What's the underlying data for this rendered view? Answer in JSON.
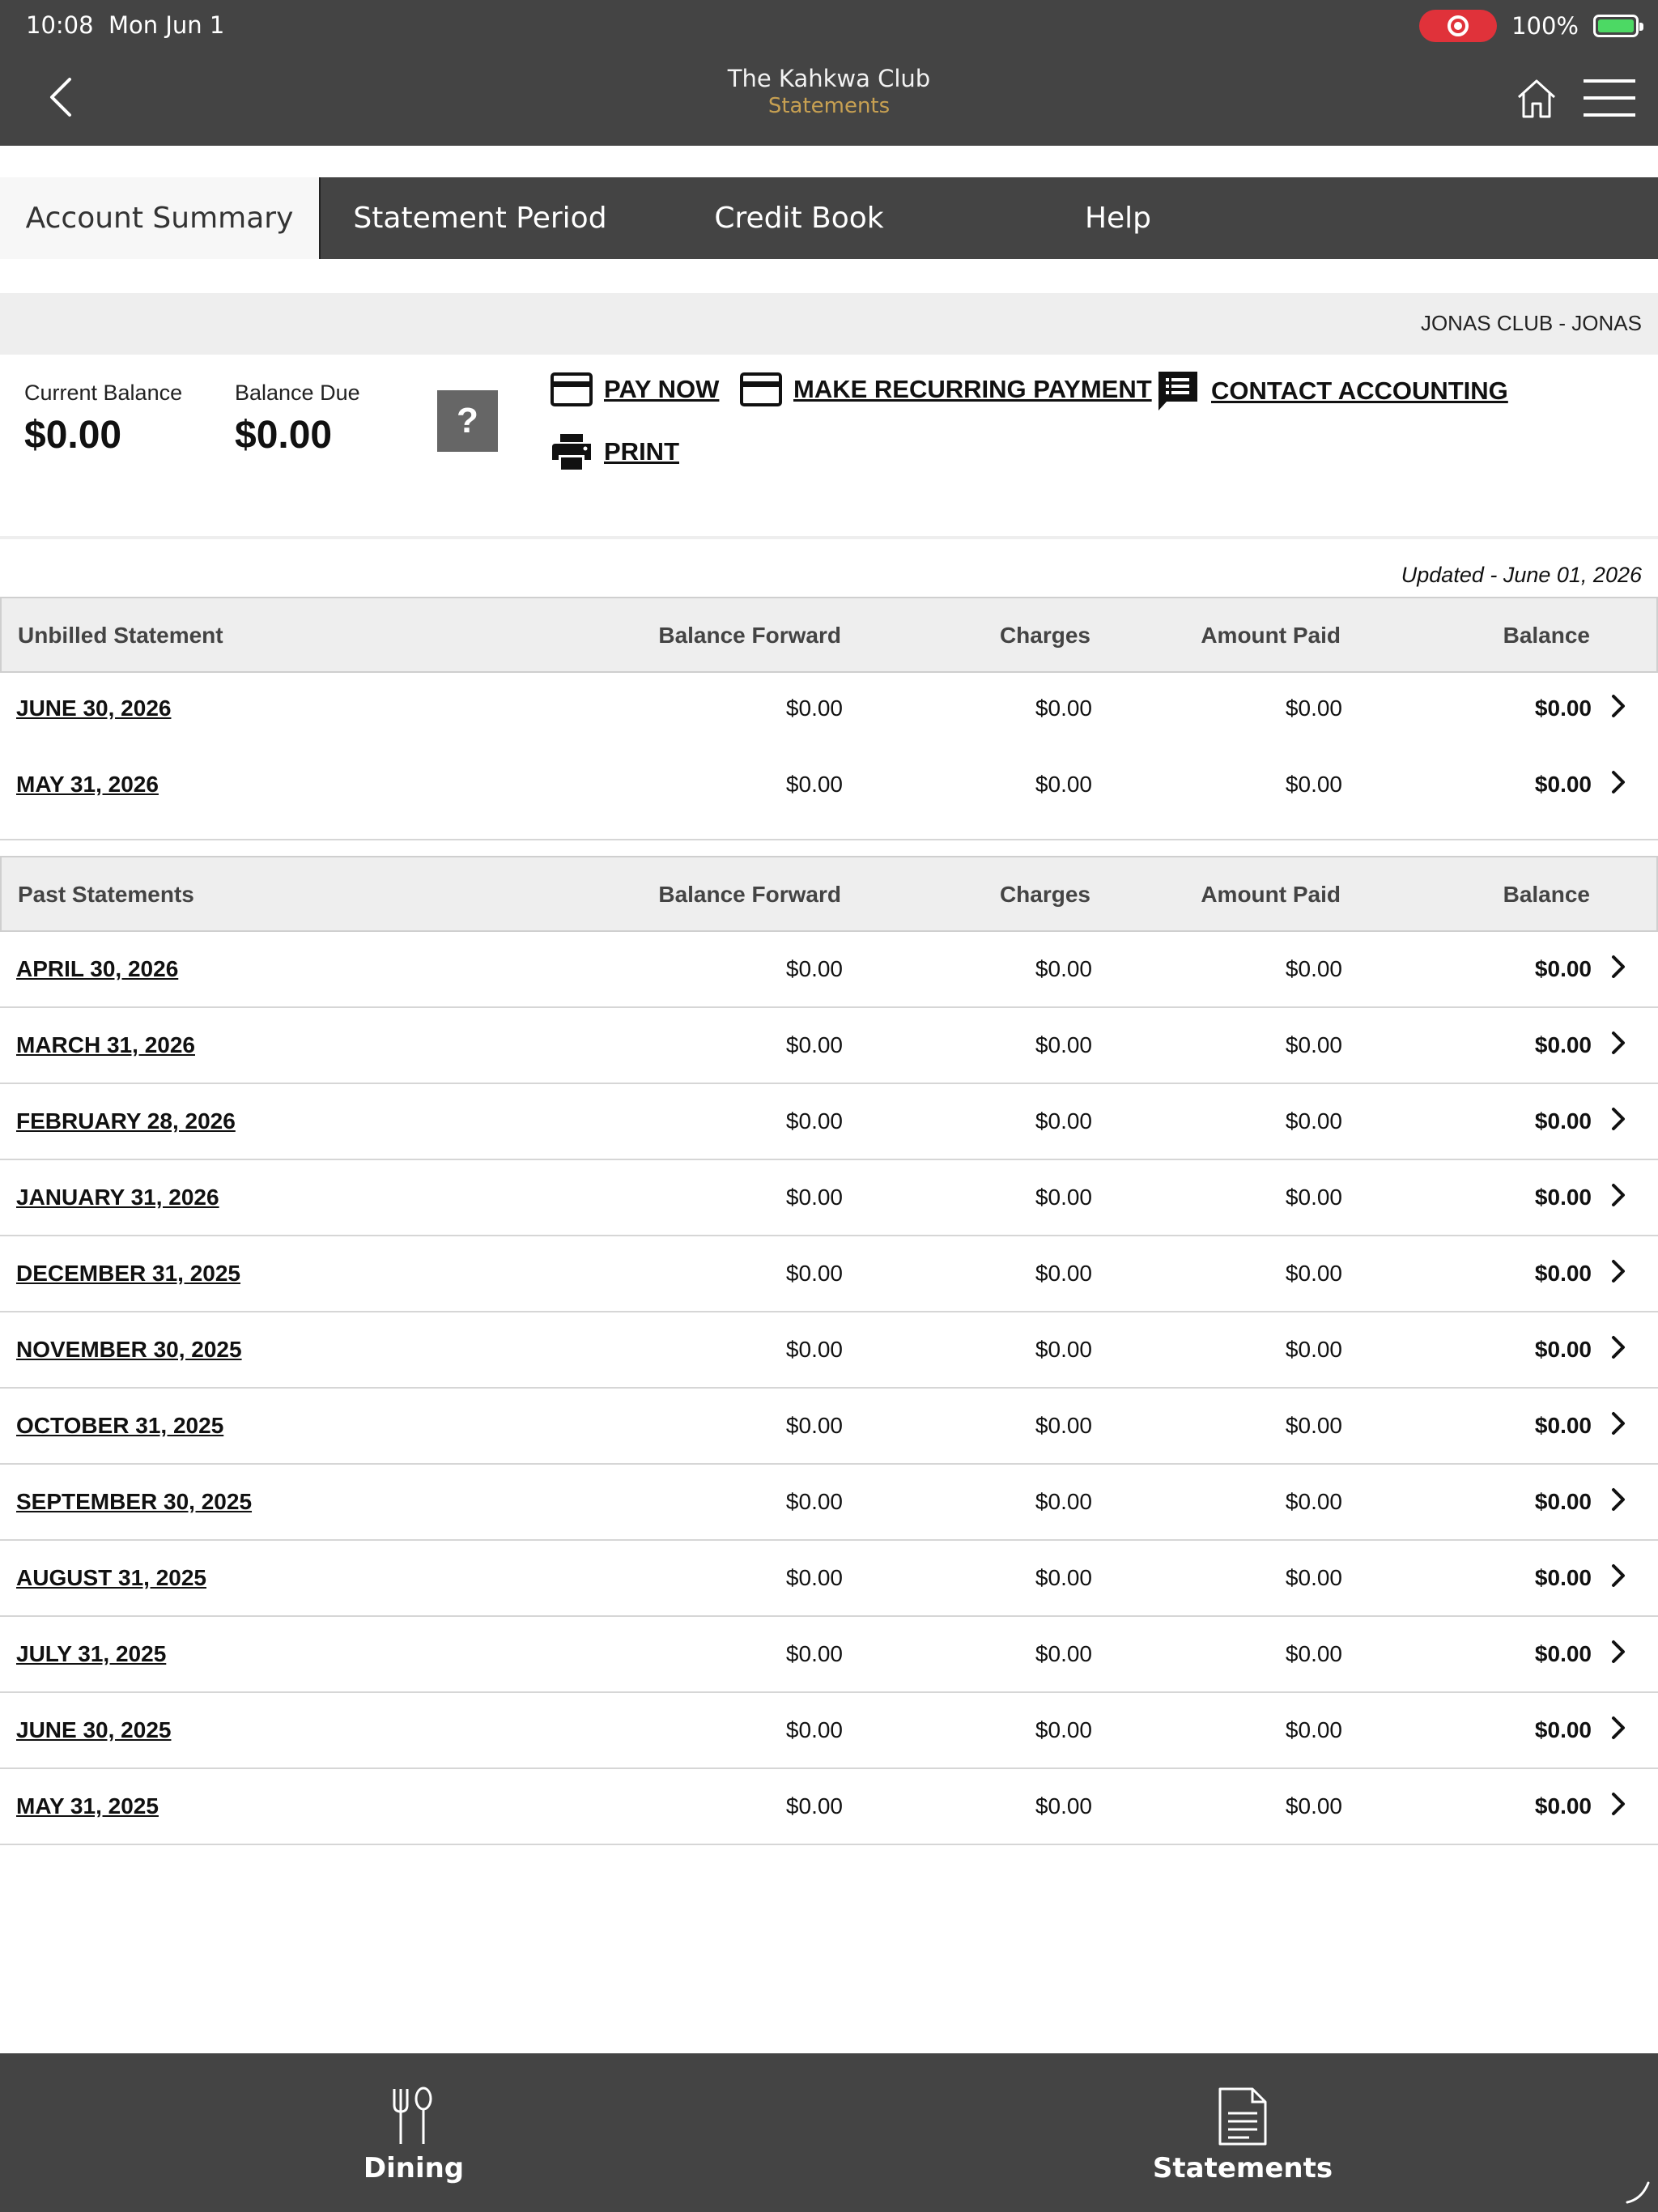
{
  "status": {
    "time": "10:08",
    "date": "Mon Jun 1",
    "battery": "100%"
  },
  "header": {
    "title": "The Kahkwa Club",
    "subtitle": "Statements"
  },
  "tabs": [
    "Account Summary",
    "Statement Period",
    "Credit Book",
    "Help"
  ],
  "club_name": "JONAS CLUB - JONAS",
  "balances": {
    "current_label": "Current Balance",
    "current_value": "$0.00",
    "due_label": "Balance Due",
    "due_value": "$0.00",
    "help_label": "?"
  },
  "actions": {
    "pay_now": "PAY NOW",
    "recurring": "MAKE RECURRING PAYMENT",
    "contact": "CONTACT ACCOUNTING",
    "print": "PRINT"
  },
  "updated": "Updated - June 01, 2026",
  "columns": [
    "Balance Forward",
    "Charges",
    "Amount Paid",
    "Balance"
  ],
  "unbilled": {
    "heading": "Unbilled Statement",
    "rows": [
      {
        "date": "JUNE 30, 2026",
        "bf": "$0.00",
        "charges": "$0.00",
        "paid": "$0.00",
        "balance": "$0.00"
      },
      {
        "date": "MAY 31, 2026",
        "bf": "$0.00",
        "charges": "$0.00",
        "paid": "$0.00",
        "balance": "$0.00"
      }
    ]
  },
  "past": {
    "heading": "Past Statements",
    "rows": [
      {
        "date": "APRIL 30, 2026",
        "bf": "$0.00",
        "charges": "$0.00",
        "paid": "$0.00",
        "balance": "$0.00"
      },
      {
        "date": "MARCH 31, 2026",
        "bf": "$0.00",
        "charges": "$0.00",
        "paid": "$0.00",
        "balance": "$0.00"
      },
      {
        "date": "FEBRUARY 28, 2026",
        "bf": "$0.00",
        "charges": "$0.00",
        "paid": "$0.00",
        "balance": "$0.00"
      },
      {
        "date": "JANUARY 31, 2026",
        "bf": "$0.00",
        "charges": "$0.00",
        "paid": "$0.00",
        "balance": "$0.00"
      },
      {
        "date": "DECEMBER 31, 2025",
        "bf": "$0.00",
        "charges": "$0.00",
        "paid": "$0.00",
        "balance": "$0.00"
      },
      {
        "date": "NOVEMBER 30, 2025",
        "bf": "$0.00",
        "charges": "$0.00",
        "paid": "$0.00",
        "balance": "$0.00"
      },
      {
        "date": "OCTOBER 31, 2025",
        "bf": "$0.00",
        "charges": "$0.00",
        "paid": "$0.00",
        "balance": "$0.00"
      },
      {
        "date": "SEPTEMBER 30, 2025",
        "bf": "$0.00",
        "charges": "$0.00",
        "paid": "$0.00",
        "balance": "$0.00"
      },
      {
        "date": "AUGUST 31, 2025",
        "bf": "$0.00",
        "charges": "$0.00",
        "paid": "$0.00",
        "balance": "$0.00"
      },
      {
        "date": "JULY 31, 2025",
        "bf": "$0.00",
        "charges": "$0.00",
        "paid": "$0.00",
        "balance": "$0.00"
      },
      {
        "date": "JUNE 30, 2025",
        "bf": "$0.00",
        "charges": "$0.00",
        "paid": "$0.00",
        "balance": "$0.00"
      },
      {
        "date": "MAY 31, 2025",
        "bf": "$0.00",
        "charges": "$0.00",
        "paid": "$0.00",
        "balance": "$0.00"
      }
    ]
  },
  "bottom_nav": {
    "dining": "Dining",
    "statements": "Statements"
  },
  "colors": {
    "header_bg": "#444444",
    "accent_gold": "#c7a052",
    "band_gray": "#eeeeee",
    "record_red": "#e0323a",
    "battery_green": "#4cd964"
  },
  "icons": [
    "back-chevron-icon",
    "home-icon",
    "hamburger-menu-icon",
    "credit-card-icon",
    "chat-message-icon",
    "printer-icon",
    "chevron-right-icon",
    "fork-spoon-icon",
    "document-icon"
  ]
}
